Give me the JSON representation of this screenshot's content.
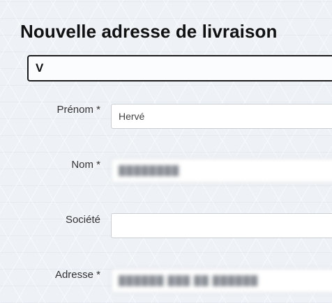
{
  "page": {
    "title": "Nouvelle adresse de livraison"
  },
  "address_select": {
    "value": "V"
  },
  "form": {
    "fields": [
      {
        "label": "Prénom *",
        "value": "Hervé",
        "blurred": false
      },
      {
        "label": "Nom *",
        "value": "████████",
        "blurred": true
      },
      {
        "label": "Société",
        "value": "",
        "blurred": false
      },
      {
        "label": "Adresse *",
        "value": "██████ ███ ██ ██████",
        "blurred": true
      }
    ]
  }
}
